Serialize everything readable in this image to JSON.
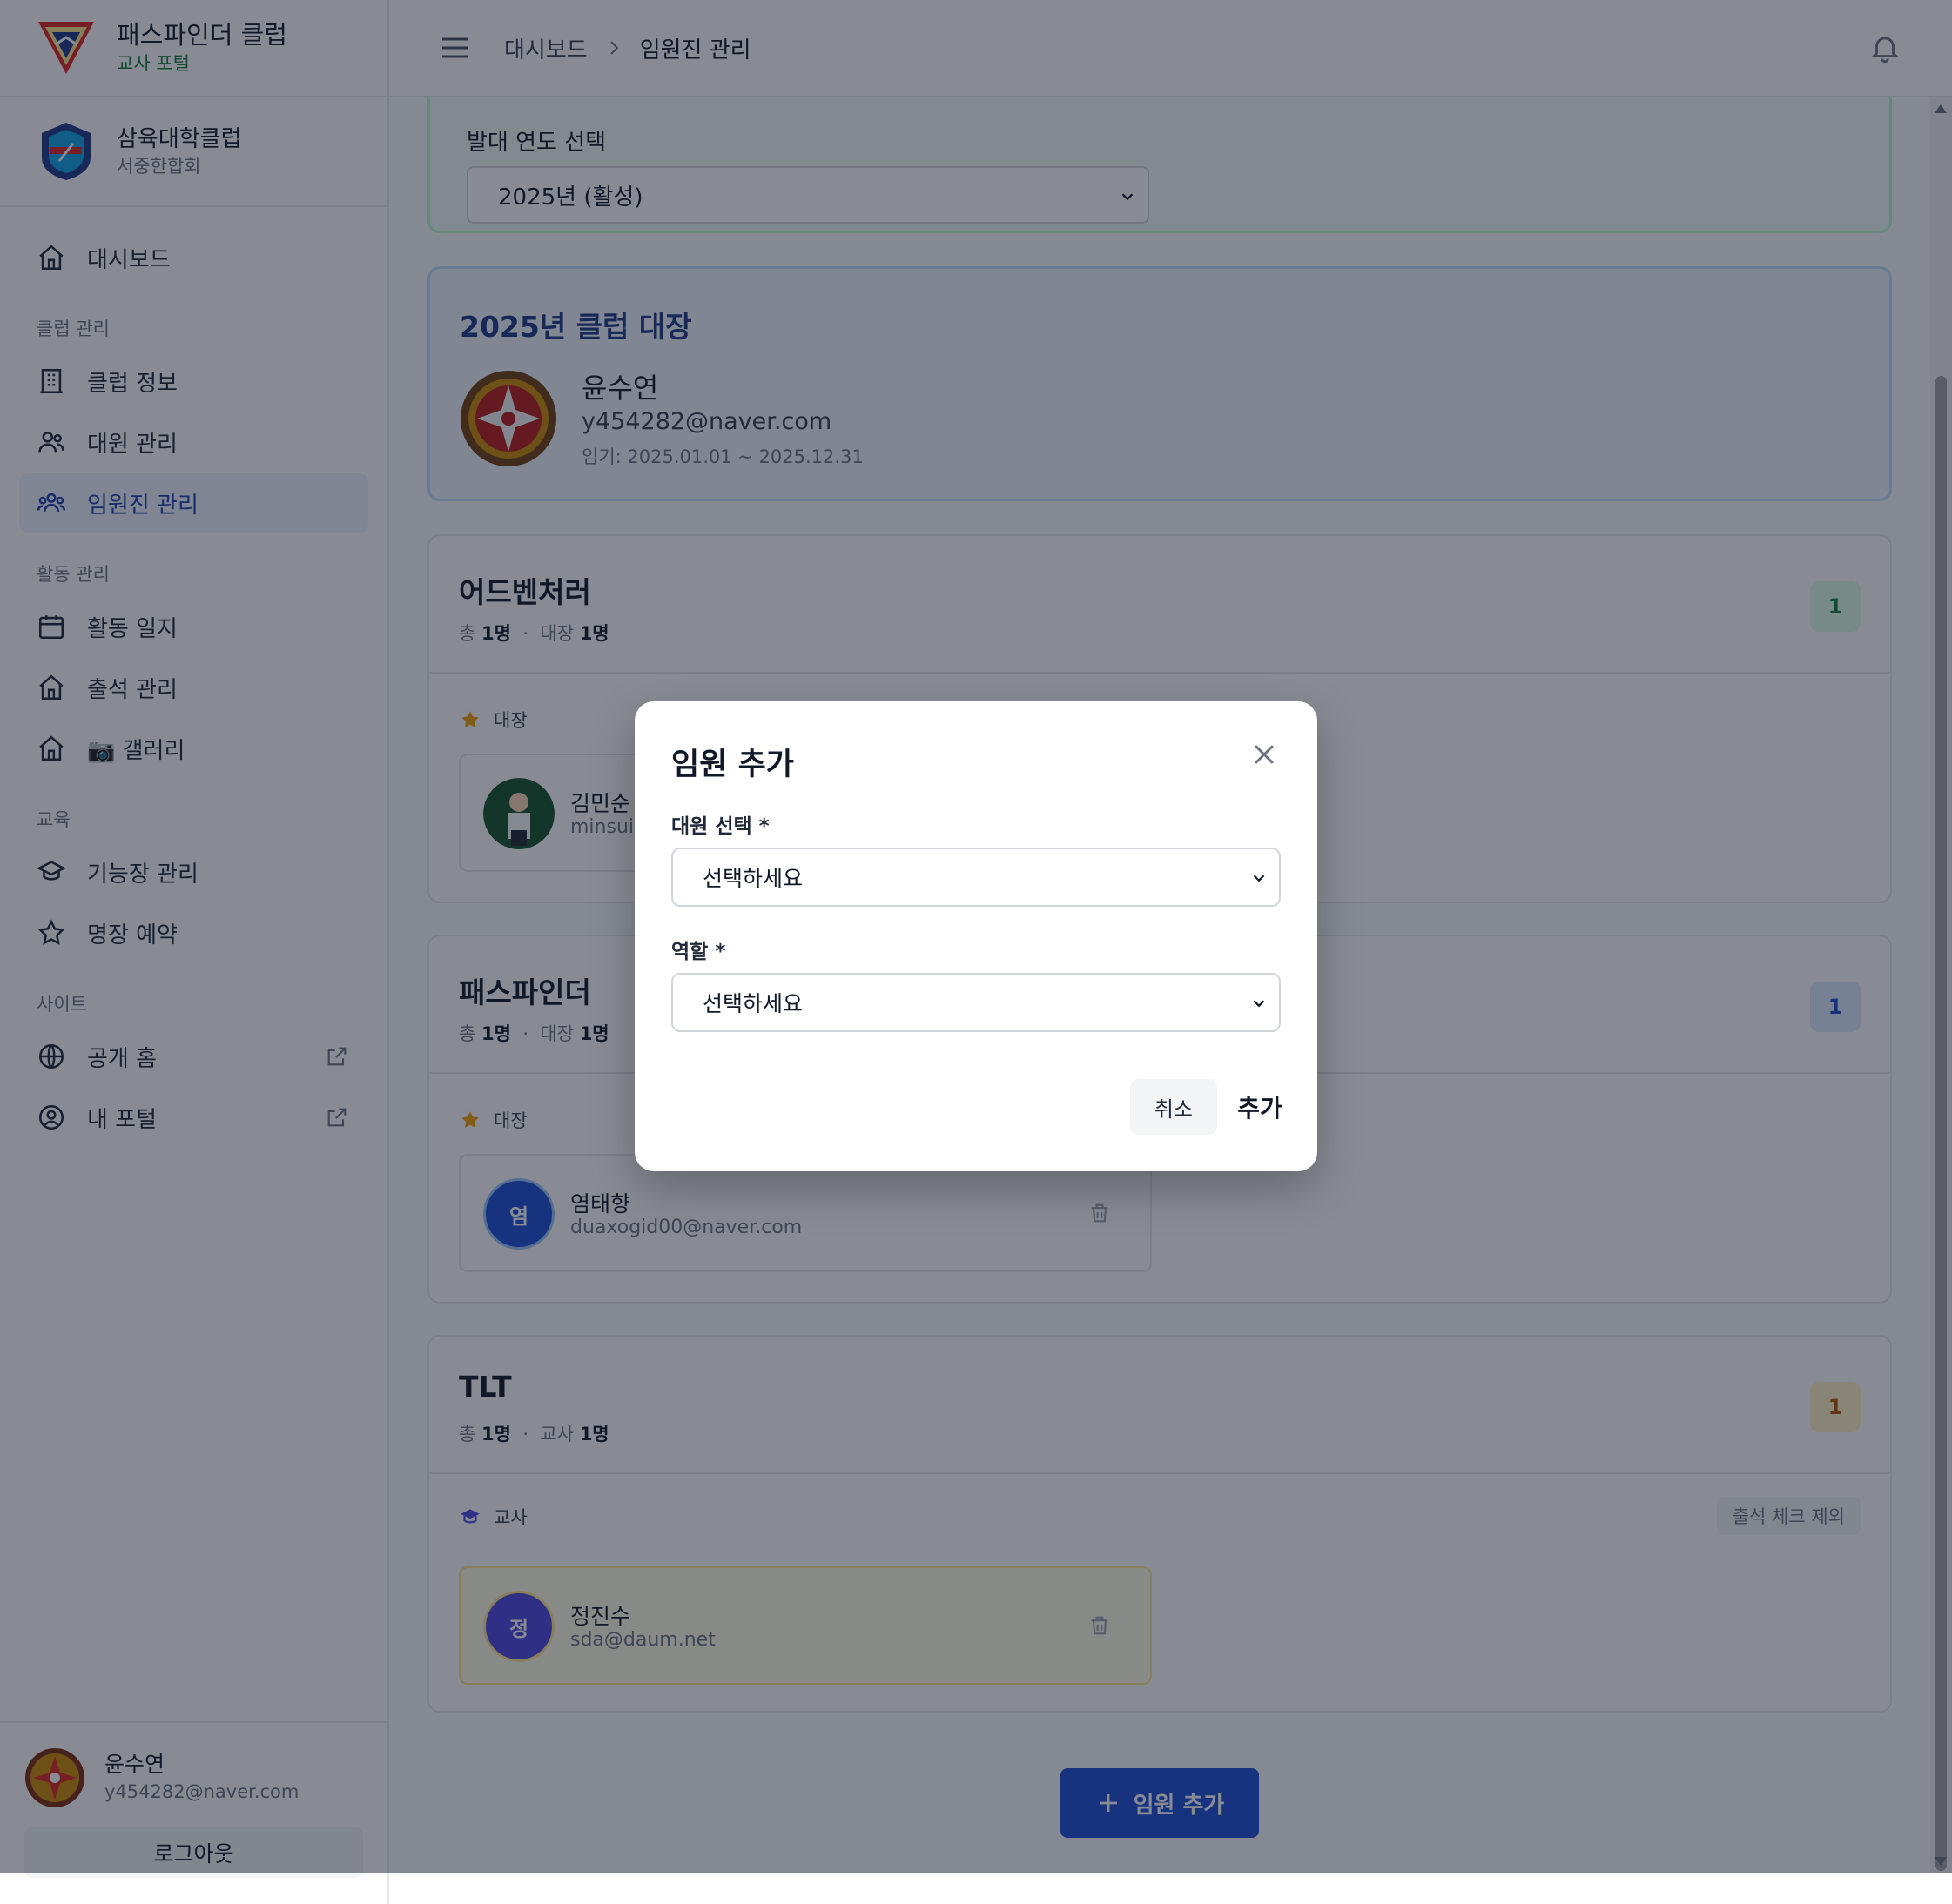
{
  "brand": {
    "title": "패스파인더 클럽",
    "subtitle": "교사 포털"
  },
  "club": {
    "name": "삼육대학클럽",
    "conference": "서중한합회"
  },
  "nav": {
    "dashboard": "대시보드",
    "section_club": "클럽 관리",
    "club_info": "클럽 정보",
    "members": "대원 관리",
    "officers": "임원진 관리",
    "section_activity": "활동 관리",
    "activity_log": "활동 일지",
    "attendance": "출석 관리",
    "gallery": "📷 갤러리",
    "section_edu": "교육",
    "honors": "기능장 관리",
    "badge_booking": "명장 예약",
    "section_site": "사이트",
    "public_home": "공개 홈",
    "my_portal": "내 포털"
  },
  "user": {
    "name": "윤수연",
    "email": "y454282@naver.com",
    "logout": "로그아웃"
  },
  "header": {
    "crumb_root": "대시보드",
    "crumb_current": "임원진 관리"
  },
  "year": {
    "label": "발대 연도 선택",
    "selected": "2025년 (활성)"
  },
  "leader": {
    "title": "2025년 클럽 대장",
    "name": "윤수연",
    "email": "y454282@naver.com",
    "term": "임기: 2025.01.01 ~ 2025.12.31"
  },
  "sections": {
    "adventurer": {
      "title": "어드벤처러",
      "total_label": "총",
      "total": "1명",
      "dot": "·",
      "role_label": "대장",
      "role_count": "1명",
      "count": "1",
      "role": "대장",
      "member_name": "김민순",
      "member_email": "minsui@"
    },
    "pathfinder": {
      "title": "패스파인더",
      "total_label": "총",
      "total": "1명",
      "dot": "·",
      "role_label": "대장",
      "role_count": "1명",
      "count": "1",
      "role": "대장",
      "member_initial": "염",
      "member_name": "염태향",
      "member_email": "duaxogid00@naver.com"
    },
    "tlt": {
      "title": "TLT",
      "total_label": "총",
      "total": "1명",
      "dot": "·",
      "role_label": "교사",
      "role_count": "1명",
      "count": "1",
      "role": "교사",
      "exclude_pill": "출석 체크 제외",
      "member_initial": "정",
      "member_name": "정진수",
      "member_email": "sda@daum.net"
    }
  },
  "add_button": "임원 추가",
  "modal": {
    "title": "임원 추가",
    "member_label": "대원 선택 *",
    "member_value": "선택하세요",
    "role_label": "역할 *",
    "role_value": "선택하세요",
    "cancel": "취소",
    "confirm": "추가"
  },
  "colors": {
    "primary": "#1d4ed8",
    "active_nav_bg": "#eef2ff",
    "green_accent": "#15803d",
    "star": "#f59e0b",
    "overlay": "rgba(17,24,39,0.5)"
  }
}
